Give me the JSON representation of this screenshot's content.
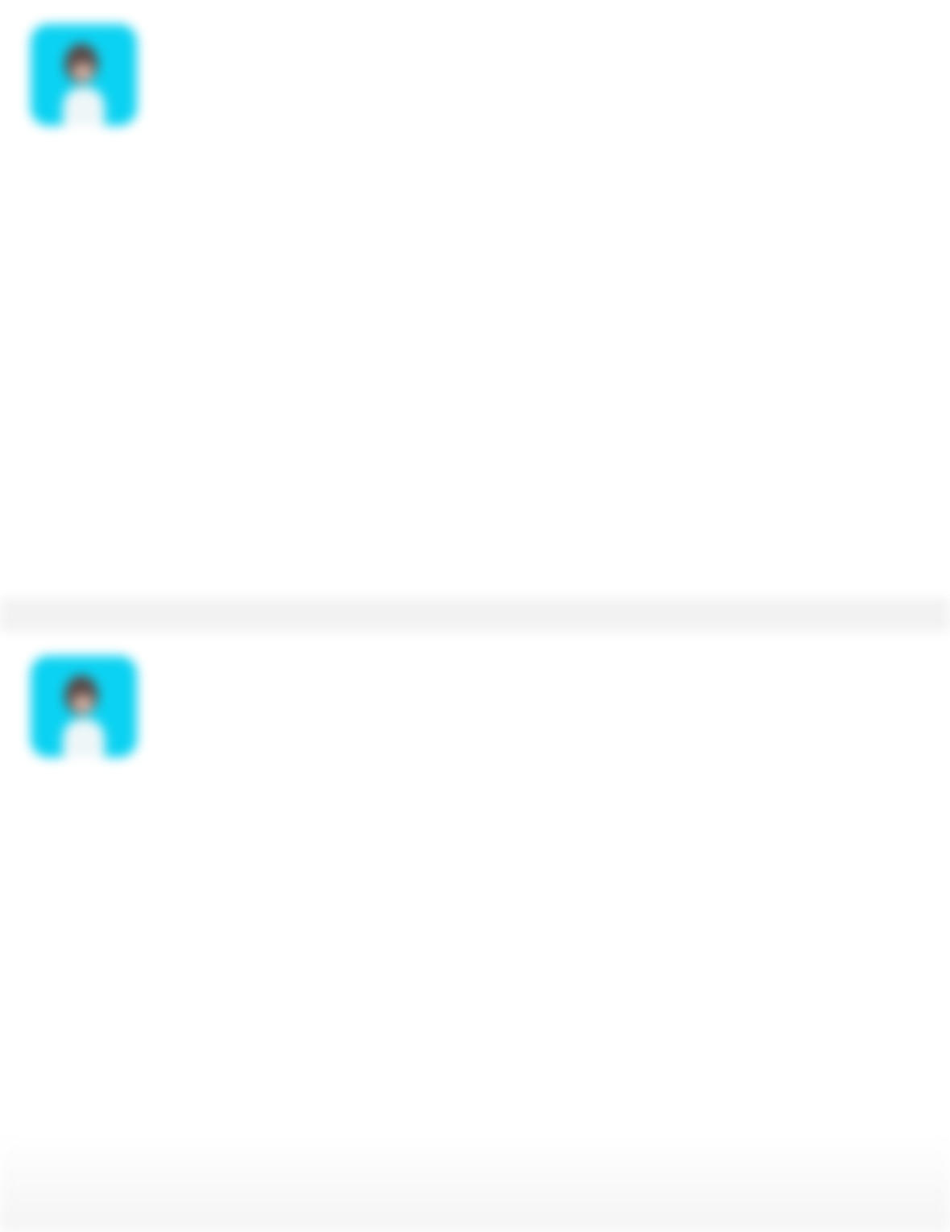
{
  "posts": [
    {
      "username": "",
      "timestamp": "",
      "content": ""
    },
    {
      "username": "",
      "timestamp": "",
      "content": ""
    }
  ],
  "avatar": {
    "icon": "avatar-icon",
    "background": "#0bd2f2"
  },
  "colors": {
    "separator": "#f2f2f2",
    "text": "#2a2a2a",
    "meta": "#a8a8a8"
  }
}
